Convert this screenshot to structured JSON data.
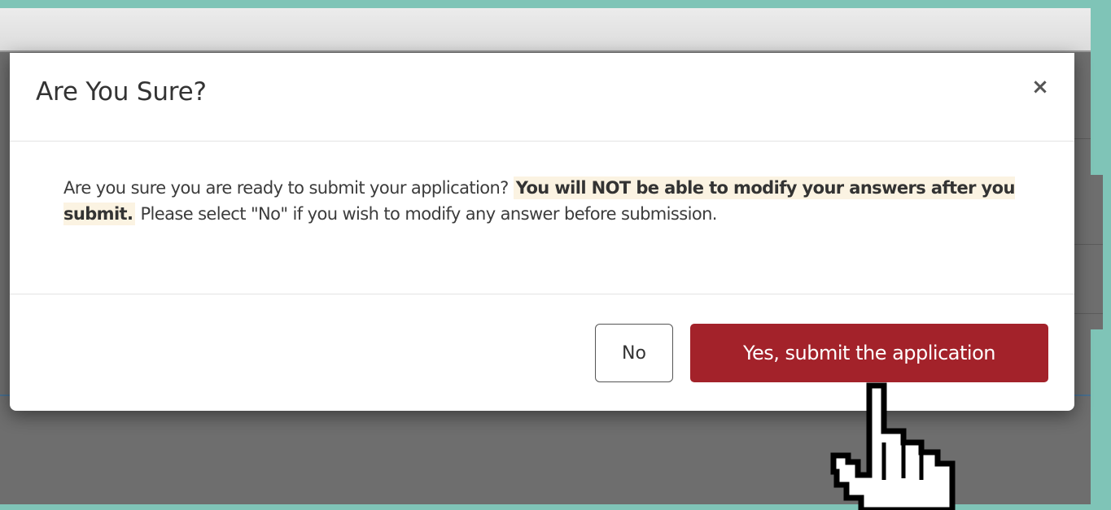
{
  "modal": {
    "title": "Are You Sure?",
    "close_label": "×",
    "body": {
      "part1": "Are you sure you are ready to submit your application? ",
      "emphasis": "You will NOT be able to modify your answers after you submit.",
      "part2": " Please select \"No\" if you wish to modify any answer before submission."
    },
    "buttons": {
      "no_label": "No",
      "yes_label": "Yes, submit the application"
    }
  },
  "colors": {
    "frame": "#7fc4b7",
    "backdrop": "#6e6e6e",
    "primary_button": "#a3222a",
    "highlight": "#fbf3e2"
  },
  "icons": {
    "close": "close-icon",
    "cursor": "hand-pointer-icon"
  }
}
